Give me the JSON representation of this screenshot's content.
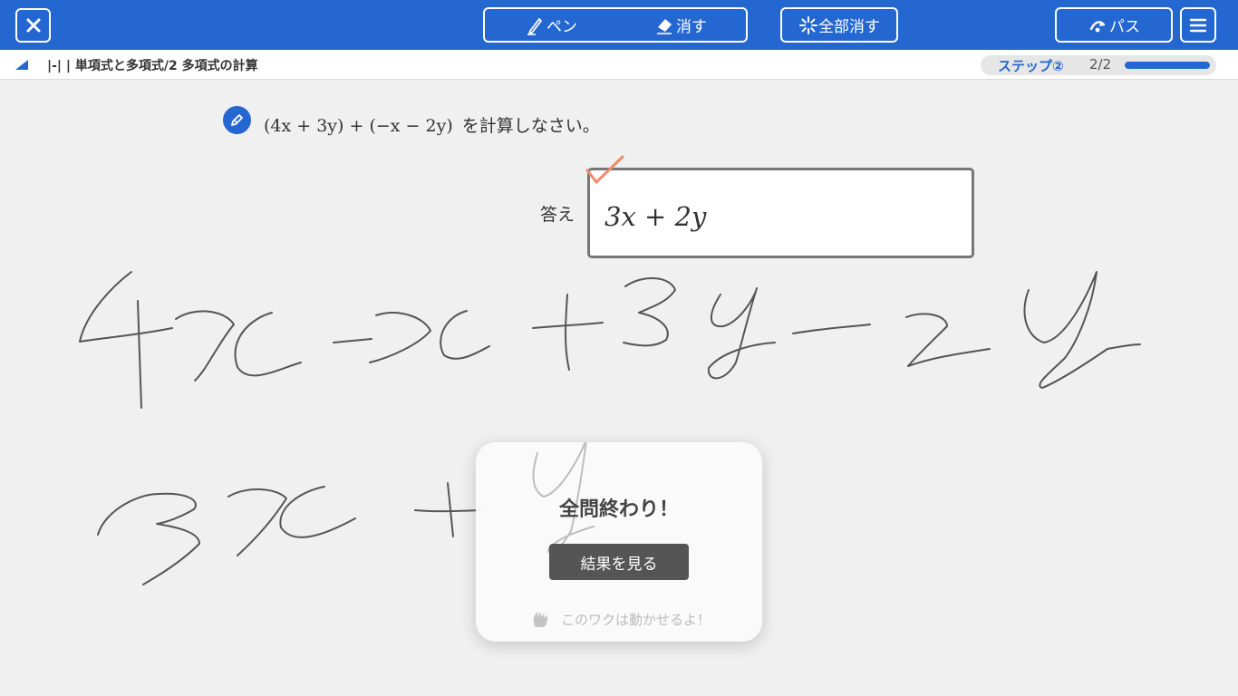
{
  "toolbar": {
    "pen_label": "ペン",
    "eraser_label": "消す",
    "clear_all_label": "全部消す",
    "pass_label": "パス",
    "accent_color": "#2467d0"
  },
  "breadcrumb": {
    "text": "|-| | 単項式と多項式/2 多項式の計算"
  },
  "step": {
    "label": "ステップ②",
    "count": "2/2",
    "progress": 1.0
  },
  "question": {
    "expression": "(4x + 3y) + (−x − 2y)",
    "suffix": "を計算しなさい。"
  },
  "answer": {
    "label": "答え",
    "value": "3x + 2y",
    "status": "correct",
    "check_color": "#f08a6a"
  },
  "popup": {
    "title": "全問終わり！",
    "result_button": "結果を見る",
    "hint": "このワクは動かせるよ！"
  },
  "icons": {
    "close": "close-icon",
    "pen": "pen-icon",
    "eraser": "eraser-icon",
    "clear_all": "sparkle-icon",
    "pass": "skip-arrow-icon",
    "menu": "hamburger-menu-icon",
    "question": "pencil-circle-icon",
    "hint": "hand-icon"
  }
}
